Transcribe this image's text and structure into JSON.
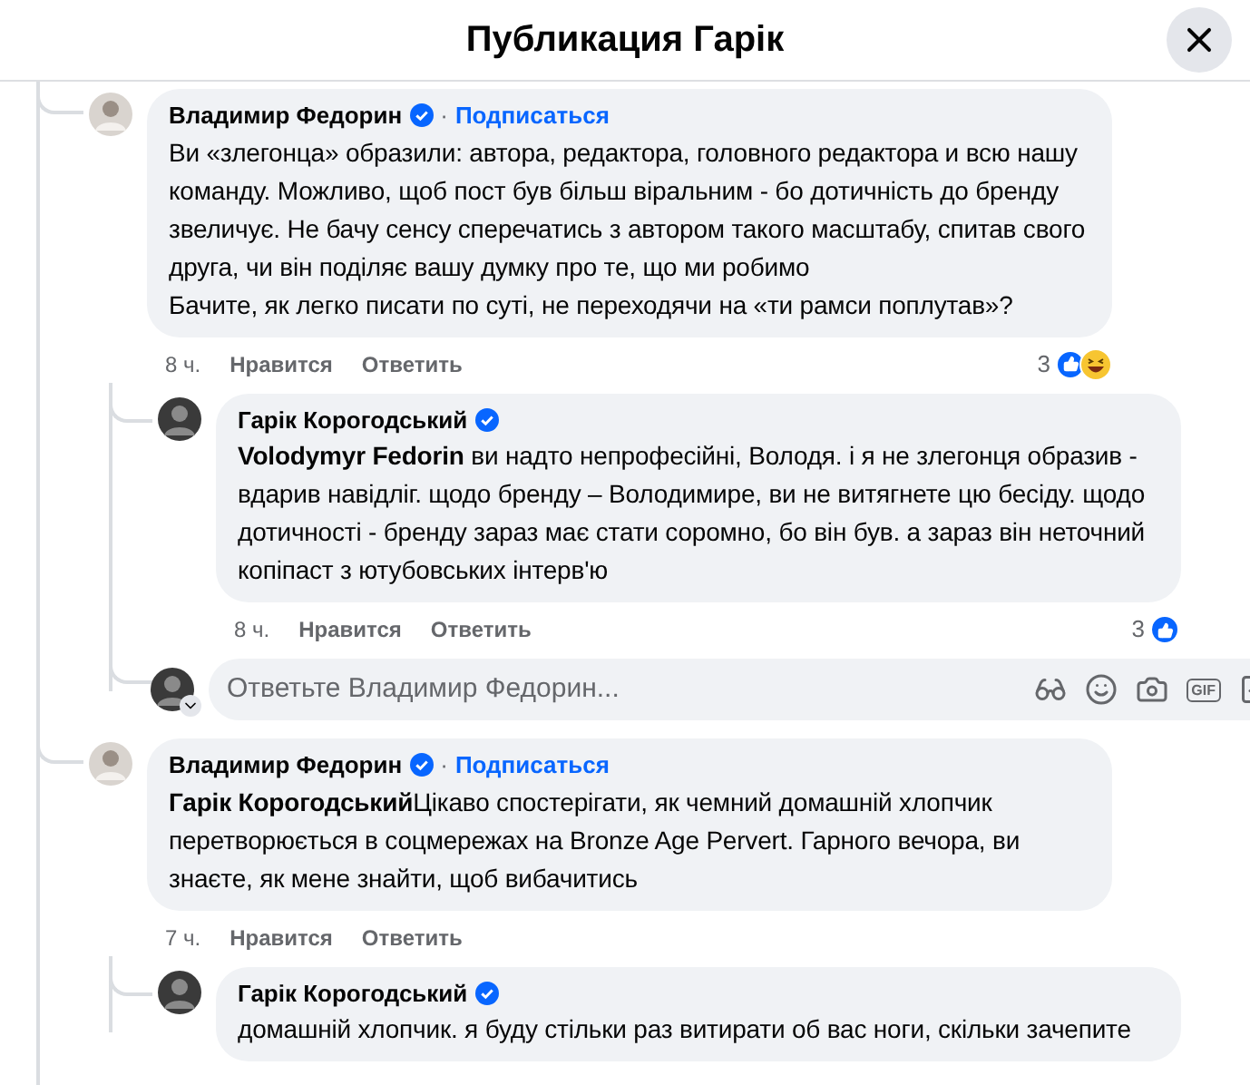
{
  "header": {
    "title": "Публикация Гарік"
  },
  "comments": [
    {
      "author": "Владимир Федорин",
      "verified": true,
      "separator": "·",
      "follow": "Подписаться",
      "paragraphs": [
        "Ви «злегонца» образили: автора, редактора, головного редактора и всю нашу команду. Можливо, щоб пост був більш віральним - бо дотичність до бренду звеличує. Не бачу сенсу сперечатись з автором такого масштабу, спитав свого друга, чи він поділяє вашу думку про те, що ми робимо",
        "Бачите, як легко писати по суті, не переходячи на «ти рамси поплутав»?"
      ],
      "time": "8 ч.",
      "like": "Нравится",
      "reply": "Ответить",
      "reaction_count": "3",
      "reactions": [
        {
          "kind": "like"
        },
        {
          "kind": "haha"
        }
      ],
      "replies": [
        {
          "author": "Гарік Корогодський",
          "verified": true,
          "paragraphs": [
            "**Volodymyr Fedorin** ви надто непрофесійні, Володя. і я не злегонця образив - вдарив навідліг. щодо бренду – Володимире, ви не витягнете цю бесіду. щодо дотичності - бренду зараз має стати соромно, бо він був. а зараз він неточний копіпаст з ютубовських інтерв'ю"
          ],
          "time": "8 ч.",
          "like": "Нравится",
          "reply": "Ответить",
          "reaction_count": "3",
          "reactions": [
            {
              "kind": "like"
            }
          ]
        }
      ],
      "reply_box": {
        "placeholder": "Ответьте Владимир Федорин...",
        "gif": "GIF"
      }
    },
    {
      "author": "Владимир Федорин",
      "verified": true,
      "separator": "·",
      "follow": "Подписаться",
      "paragraphs": [
        "**Гарік Корогодський**Цікаво спостерігати, як чемний домашній хлопчик перетворюється в соцмережах на Bronze Age Pervert. Гарного вечора, ви знаєте, як мене знайти, щоб вибачитись"
      ],
      "time": "7 ч.",
      "like": "Нравится",
      "reply": "Ответить",
      "replies": [
        {
          "author": "Гарік Корогодський",
          "verified": true,
          "paragraphs": [
            "домашній хлопчик. я буду стільки раз витирати об вас ноги, скільки зачепите"
          ]
        }
      ]
    }
  ]
}
